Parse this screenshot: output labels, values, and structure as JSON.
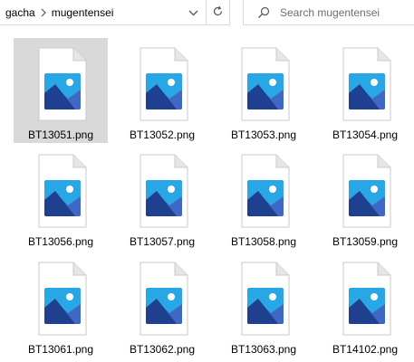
{
  "breadcrumb": {
    "parent": "gacha",
    "current": "mugentensei"
  },
  "search": {
    "placeholder": "Search mugentensei"
  },
  "files": [
    {
      "name": "BT13051.png",
      "selected": true
    },
    {
      "name": "BT13052.png",
      "selected": false
    },
    {
      "name": "BT13053.png",
      "selected": false
    },
    {
      "name": "BT13054.png",
      "selected": false
    },
    {
      "name": "BT13056.png",
      "selected": false
    },
    {
      "name": "BT13057.png",
      "selected": false
    },
    {
      "name": "BT13058.png",
      "selected": false
    },
    {
      "name": "BT13059.png",
      "selected": false
    },
    {
      "name": "BT13061.png",
      "selected": false
    },
    {
      "name": "BT13062.png",
      "selected": false
    },
    {
      "name": "BT13063.png",
      "selected": false
    },
    {
      "name": "BT14102.png",
      "selected": false
    }
  ],
  "colors": {
    "selection": "#d9d9d9",
    "border": "#d9d9d9",
    "page": "#ffffff",
    "page_fold": "#e6e6e6",
    "image_sky": "#29a6e6",
    "image_sun": "#ffffff",
    "mountain_back": "#3f67c6",
    "mountain_front": "#1f3f8f"
  }
}
